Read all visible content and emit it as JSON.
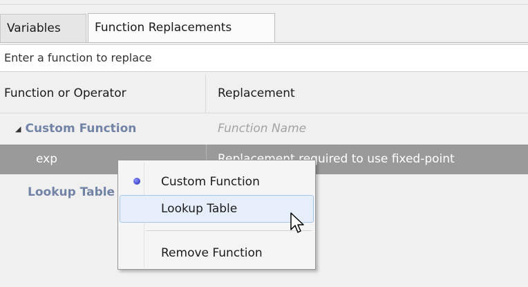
{
  "tabs": [
    {
      "label": "Variables",
      "active": false
    },
    {
      "label": "Function Replacements",
      "active": true
    }
  ],
  "search": {
    "placeholder": "Enter a function to replace",
    "value": ""
  },
  "table": {
    "columns": [
      "Function or Operator",
      "Replacement"
    ],
    "rows": [
      {
        "function": "Custom Function",
        "replacement": "Function Name",
        "type": "group",
        "expanded": true
      },
      {
        "function": "exp",
        "replacement": "Replacement required to use fixed-point",
        "type": "item",
        "selected": true
      },
      {
        "function": "Lookup Table",
        "replacement": "",
        "type": "group"
      }
    ]
  },
  "context_menu": {
    "items": [
      {
        "label": "Custom Function",
        "checked": true
      },
      {
        "label": "Lookup Table",
        "hovered": true
      },
      {
        "label": "Remove Function"
      }
    ]
  },
  "icons": {
    "expand": "triangle-down-icon",
    "checked": "radio-bullet-icon",
    "cursor": "mouse-pointer-icon"
  },
  "colors": {
    "group_text": "#7283a6",
    "selected_row": "#9a9a9a",
    "menu_hover": "#e6eef9",
    "bullet": "#2b37c8"
  }
}
